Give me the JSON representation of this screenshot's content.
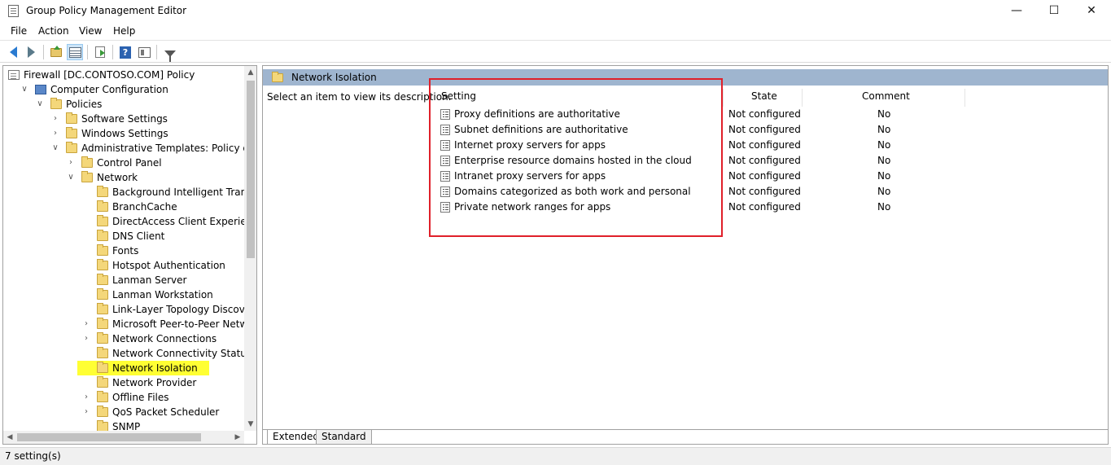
{
  "window": {
    "title": "Group Policy Management Editor",
    "minimize": "—",
    "maximize": "☐",
    "close": "✕"
  },
  "menu": [
    "File",
    "Action",
    "View",
    "Help"
  ],
  "tree": [
    {
      "label": "Firewall [DC.CONTOSO.COM] Policy",
      "indent": 0,
      "expander": "",
      "icon": "doc"
    },
    {
      "label": "Computer Configuration",
      "indent": 1,
      "expander": "∨",
      "icon": "computer"
    },
    {
      "label": "Policies",
      "indent": 2,
      "expander": "∨",
      "icon": "folder"
    },
    {
      "label": "Software Settings",
      "indent": 3,
      "expander": "›",
      "icon": "folder"
    },
    {
      "label": "Windows Settings",
      "indent": 3,
      "expander": "›",
      "icon": "folder"
    },
    {
      "label": "Administrative Templates: Policy definiti",
      "indent": 3,
      "expander": "∨",
      "icon": "folder"
    },
    {
      "label": "Control Panel",
      "indent": 4,
      "expander": "›",
      "icon": "folder"
    },
    {
      "label": "Network",
      "indent": 4,
      "expander": "∨",
      "icon": "folder"
    },
    {
      "label": "Background Intelligent Transfer S",
      "indent": 5,
      "expander": "",
      "icon": "folder"
    },
    {
      "label": "BranchCache",
      "indent": 5,
      "expander": "",
      "icon": "folder"
    },
    {
      "label": "DirectAccess Client Experience Se",
      "indent": 5,
      "expander": "",
      "icon": "folder"
    },
    {
      "label": "DNS Client",
      "indent": 5,
      "expander": "",
      "icon": "folder"
    },
    {
      "label": "Fonts",
      "indent": 5,
      "expander": "",
      "icon": "folder"
    },
    {
      "label": "Hotspot Authentication",
      "indent": 5,
      "expander": "",
      "icon": "folder"
    },
    {
      "label": "Lanman Server",
      "indent": 5,
      "expander": "",
      "icon": "folder"
    },
    {
      "label": "Lanman Workstation",
      "indent": 5,
      "expander": "",
      "icon": "folder"
    },
    {
      "label": "Link-Layer Topology Discovery",
      "indent": 5,
      "expander": "",
      "icon": "folder"
    },
    {
      "label": "Microsoft Peer-to-Peer Networkir",
      "indent": 5,
      "expander": "›",
      "icon": "folder"
    },
    {
      "label": "Network Connections",
      "indent": 5,
      "expander": "›",
      "icon": "folder"
    },
    {
      "label": "Network Connectivity Status Indi",
      "indent": 5,
      "expander": "",
      "icon": "folder"
    },
    {
      "label": "Network Isolation",
      "indent": 5,
      "expander": "",
      "icon": "folder",
      "selected": true
    },
    {
      "label": "Network Provider",
      "indent": 5,
      "expander": "",
      "icon": "folder"
    },
    {
      "label": "Offline Files",
      "indent": 5,
      "expander": "›",
      "icon": "folder"
    },
    {
      "label": "QoS Packet Scheduler",
      "indent": 5,
      "expander": "›",
      "icon": "folder"
    },
    {
      "label": "SNMP",
      "indent": 5,
      "expander": "",
      "icon": "folder"
    }
  ],
  "right": {
    "header": "Network Isolation",
    "description": "Select an item to view its description.",
    "columns": {
      "setting": "Setting",
      "state": "State",
      "comment": "Comment"
    },
    "rows": [
      {
        "name": "Proxy definitions are authoritative",
        "state": "Not configured",
        "comment": "No"
      },
      {
        "name": "Subnet definitions are authoritative",
        "state": "Not configured",
        "comment": "No"
      },
      {
        "name": "Internet proxy servers for apps",
        "state": "Not configured",
        "comment": "No"
      },
      {
        "name": "Enterprise resource domains hosted in the cloud",
        "state": "Not configured",
        "comment": "No"
      },
      {
        "name": "Intranet proxy servers for  apps",
        "state": "Not configured",
        "comment": "No"
      },
      {
        "name": "Domains categorized as both work and personal",
        "state": "Not configured",
        "comment": "No"
      },
      {
        "name": "Private network ranges for  apps",
        "state": "Not configured",
        "comment": "No"
      }
    ],
    "tabs": {
      "extended": "Extended",
      "standard": "Standard"
    }
  },
  "status": "7 setting(s)",
  "colors": {
    "selected_highlight": "#ffff33",
    "header_band": "#9fb5cf",
    "annotation_box": "#e0202a"
  }
}
